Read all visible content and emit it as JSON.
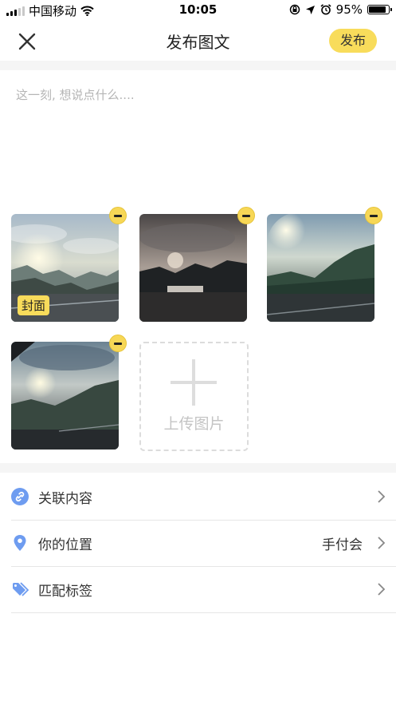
{
  "status_bar": {
    "carrier": "中国移动",
    "time": "10:05",
    "battery": "95%",
    "battery_level": 0.95
  },
  "nav": {
    "title": "发布图文",
    "publish_label": "发布",
    "close_icon": "close-icon"
  },
  "editor": {
    "placeholder": "这一刻, 想说点什么....",
    "value": ""
  },
  "photos": {
    "cover_label": "封面",
    "upload_label": "上传图片"
  },
  "options": {
    "related": {
      "label": "关联内容",
      "icon": "link-icon"
    },
    "location": {
      "label": "你的位置",
      "value": "手付会",
      "icon": "location-pin-icon"
    },
    "tags": {
      "label": "匹配标签",
      "icon": "tag-icon"
    }
  },
  "colors": {
    "accent": "#f8dc5b",
    "icon_blue": "#6e9cf0",
    "divider": "#e6e6e6",
    "section_bg": "#f5f5f5"
  }
}
